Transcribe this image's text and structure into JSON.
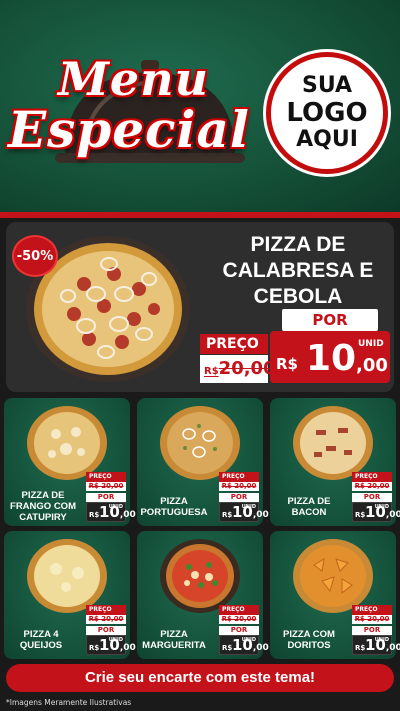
{
  "header": {
    "title_line1": "Menu",
    "title_line2": "Especial",
    "logo_lines": [
      "SUA",
      "LOGO",
      "AQUI"
    ]
  },
  "featured": {
    "discount_badge": "-50%",
    "title": "PIZZA DE CALABRESA E CEBOLA",
    "preco_label": "PREÇO",
    "por_label": "POR",
    "old_currency": "R$",
    "old_price": "20,00",
    "currency": "R$",
    "price_int": "10",
    "price_cents": ",00",
    "unit": "UNID"
  },
  "cards": [
    {
      "name": "PIZZA DE FRANGO COM CATUPIRY",
      "preco": "PREÇO",
      "old": "R$ 20,00",
      "por": "POR",
      "cur": "R$",
      "int": "10",
      "cents": ",00",
      "unit": "UNID"
    },
    {
      "name": "PIZZA PORTUGUESA",
      "preco": "PREÇO",
      "old": "R$ 20,00",
      "por": "POR",
      "cur": "R$",
      "int": "10",
      "cents": ",00",
      "unit": "UNID"
    },
    {
      "name": "PIZZA DE BACON",
      "preco": "PREÇO",
      "old": "R$ 20,00",
      "por": "POR",
      "cur": "R$",
      "int": "10",
      "cents": ",00",
      "unit": "UNID"
    },
    {
      "name": "PIZZA 4 QUEIJOS",
      "preco": "PREÇO",
      "old": "R$ 20,00",
      "por": "POR",
      "cur": "R$",
      "int": "10",
      "cents": ",00",
      "unit": "UNID"
    },
    {
      "name": "PIZZA MARGUERITA",
      "preco": "PREÇO",
      "old": "R$ 20,00",
      "por": "POR",
      "cur": "R$",
      "int": "10",
      "cents": ",00",
      "unit": "UNID"
    },
    {
      "name": "PIZZA COM DORITOS",
      "preco": "PREÇO",
      "old": "R$ 20,00",
      "por": "POR",
      "cur": "R$",
      "int": "10",
      "cents": ",00",
      "unit": "UNID"
    }
  ],
  "cta": "Crie seu encarte com este tema!",
  "footnote": "*Imagens Meramente Ilustrativas",
  "colors": {
    "accent": "#c4121a",
    "green": "#155239",
    "dark": "#1a1a1a"
  }
}
